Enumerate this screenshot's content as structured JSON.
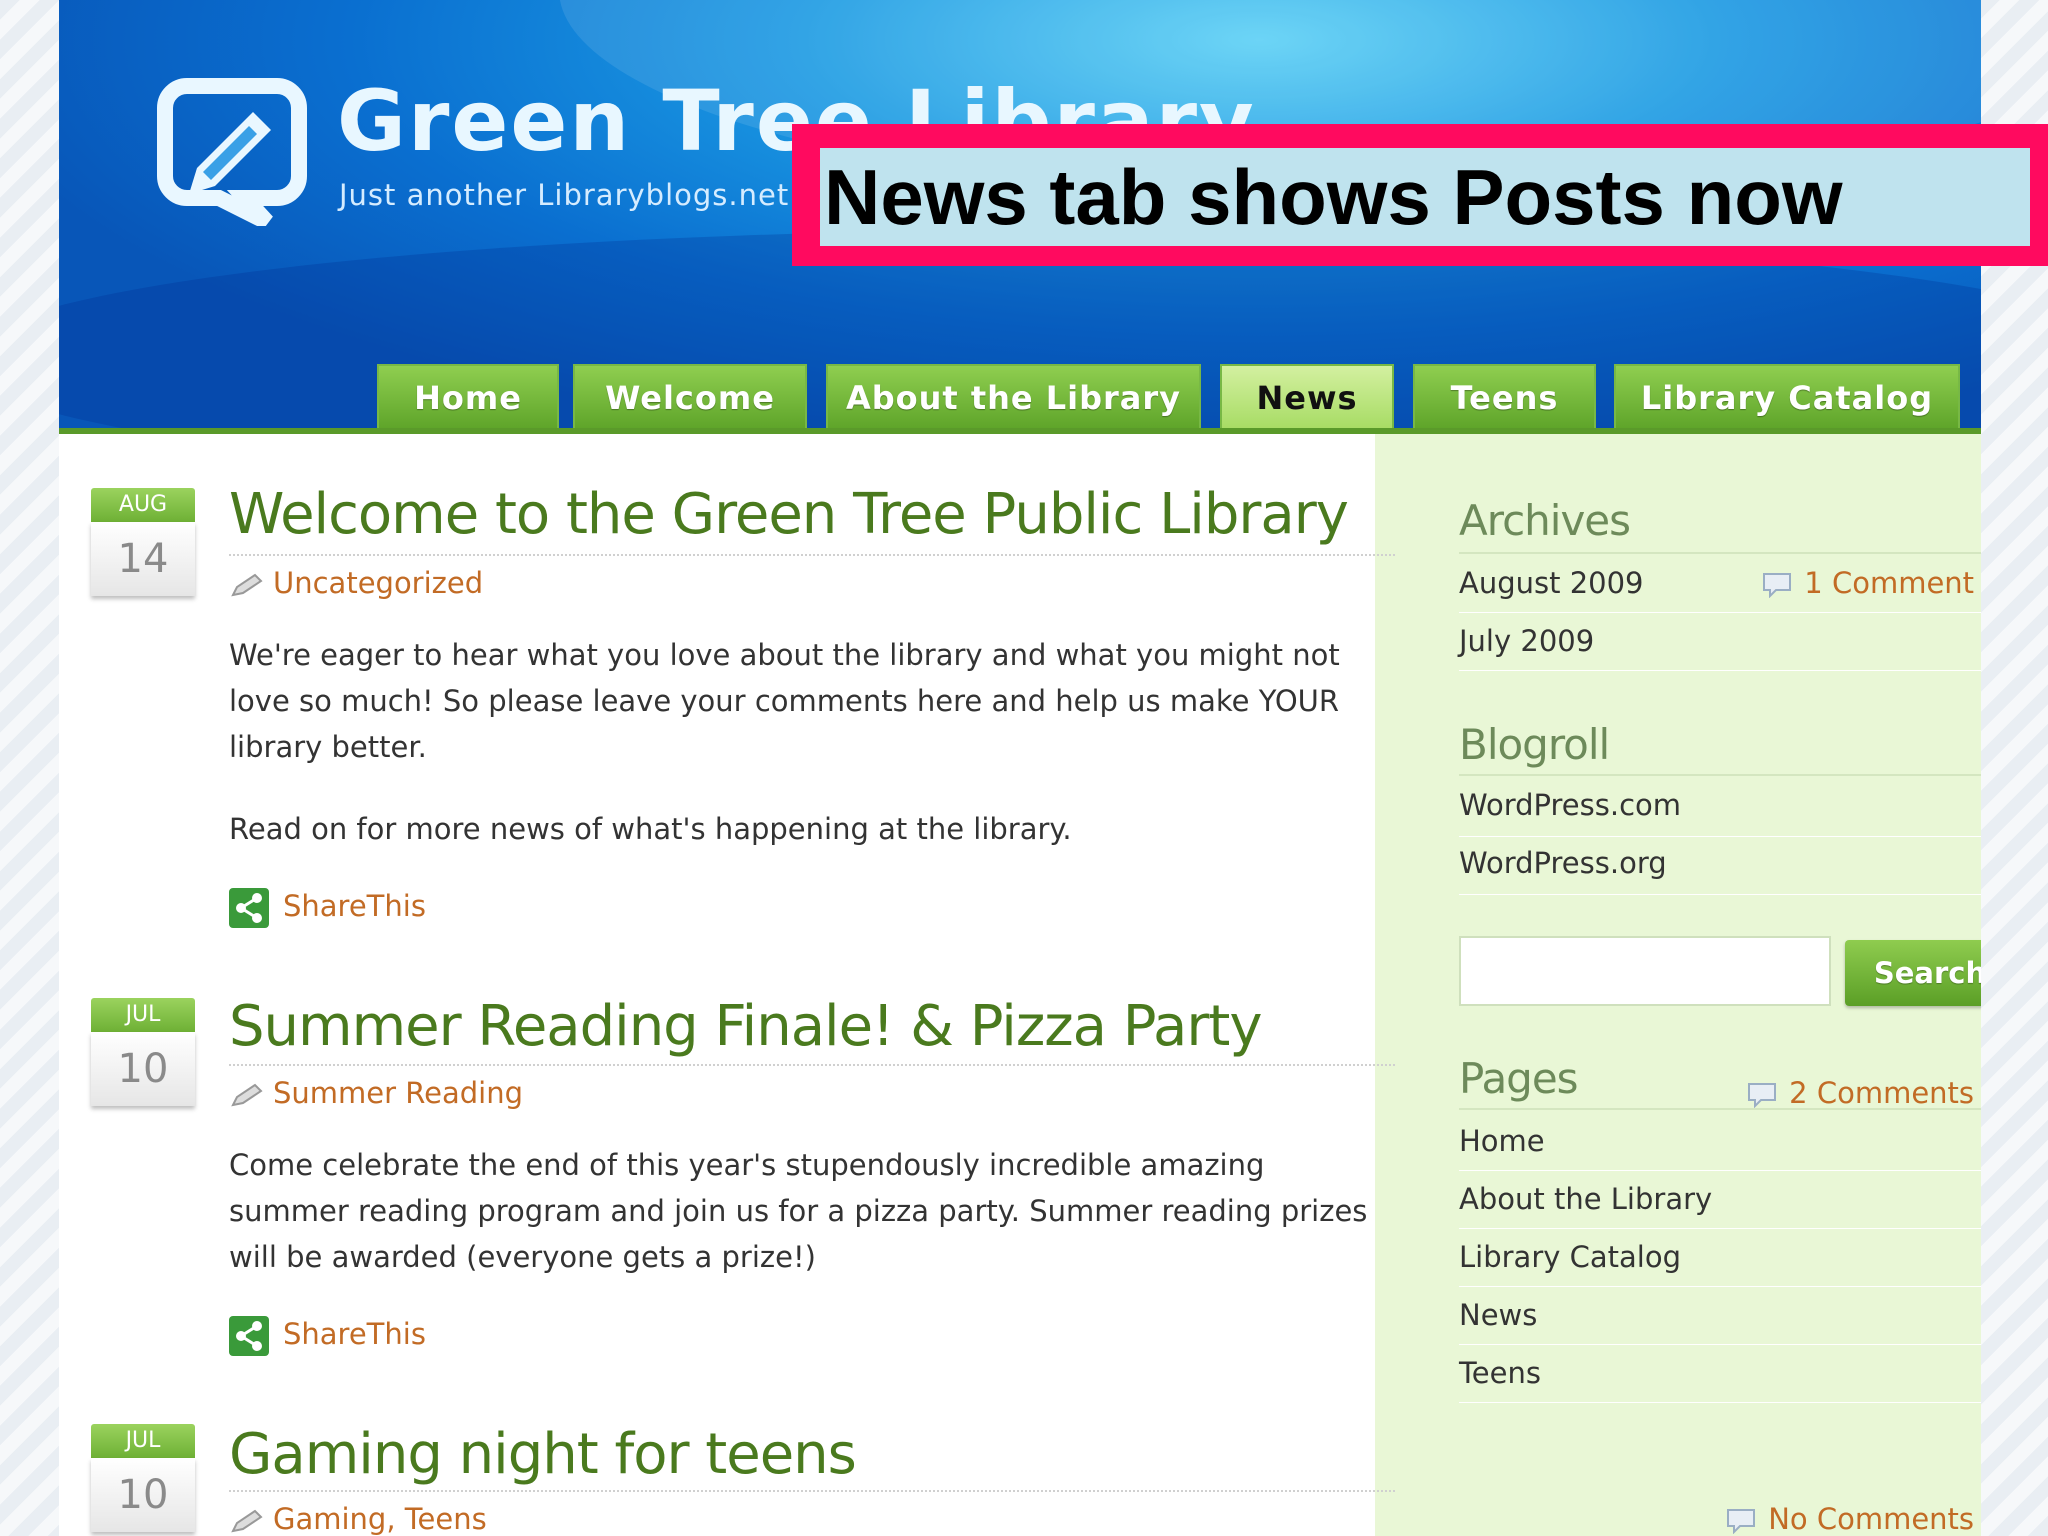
{
  "header": {
    "site_title": "Green Tree Library",
    "tagline": "Just another Libraryblogs.net"
  },
  "overlay": {
    "text": "News tab shows Posts now"
  },
  "nav": {
    "tabs": [
      {
        "label": "Home"
      },
      {
        "label": "Welcome"
      },
      {
        "label": "About the Library"
      },
      {
        "label": "News",
        "active": true
      },
      {
        "label": "Teens"
      },
      {
        "label": "Library Catalog"
      }
    ]
  },
  "posts": [
    {
      "month": "AUG",
      "day": "14",
      "title": "Welcome to the Green Tree Public Library",
      "category": "Uncategorized",
      "comments": "1 Comment »",
      "paragraphs": [
        "We're eager to hear what you love about the library and what you might not love so much! So please leave your comments here and help us make YOUR library better.",
        "Read on for more news of what's happening at the library."
      ],
      "share": "ShareThis"
    },
    {
      "month": "JUL",
      "day": "10",
      "title": "Summer Reading Finale! & Pizza Party",
      "category": "Summer Reading",
      "comments": "2 Comments »",
      "paragraphs": [
        "Come celebrate the end of this year's stupendously incredible amazing summer reading program and join us for a pizza party. Summer reading prizes will be awarded (everyone gets a prize!)"
      ],
      "share": "ShareThis"
    },
    {
      "month": "JUL",
      "day": "10",
      "title": "Gaming night for teens",
      "category": "Gaming, Teens",
      "comments": "No Comments »"
    }
  ],
  "sidebar": {
    "archives": {
      "heading": "Archives",
      "items": [
        "August 2009",
        "July 2009"
      ]
    },
    "blogroll": {
      "heading": "Blogroll",
      "items": [
        "WordPress.com",
        "WordPress.org"
      ]
    },
    "search": {
      "value": "",
      "button_label": "Search"
    },
    "pages": {
      "heading": "Pages",
      "items": [
        "Home",
        "About the Library",
        "Library Catalog",
        "News",
        "Teens"
      ]
    }
  },
  "colors": {
    "header_blue": "#0a6fd0",
    "nav_green": "#6eb035",
    "active_tab": "#bfe6a0",
    "title_green": "#4a7a1e",
    "link_orange": "#c26b25",
    "sidebar_bg": "#e9f7d6",
    "overlay_border": "#ff0a5f",
    "overlay_fill": "#bfe3ee"
  }
}
